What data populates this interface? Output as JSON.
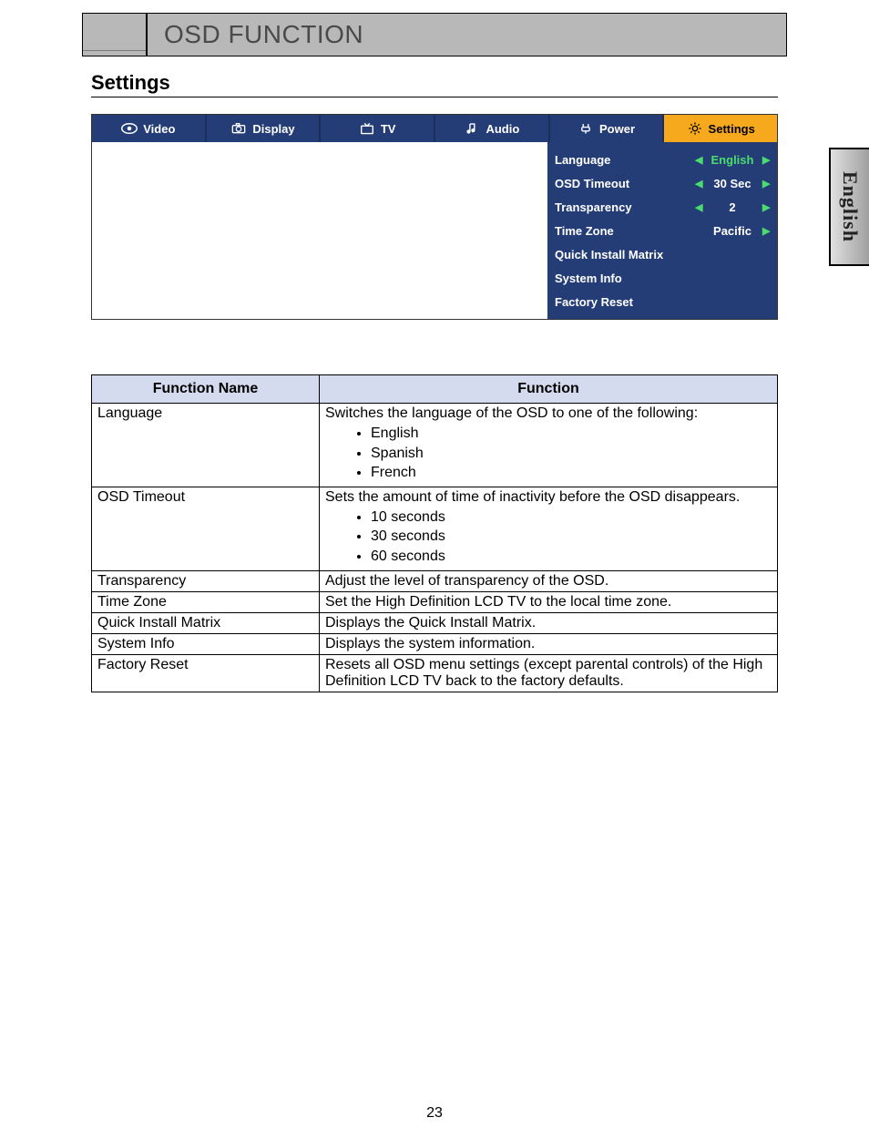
{
  "header": {
    "title": "OSD FUNCTION"
  },
  "section": {
    "title": "Settings"
  },
  "side_tab": "English",
  "page_number": "23",
  "osd": {
    "tabs": [
      {
        "label": "Video",
        "icon": "eye-icon"
      },
      {
        "label": "Display",
        "icon": "camera-icon"
      },
      {
        "label": "TV",
        "icon": "tv-icon"
      },
      {
        "label": "Audio",
        "icon": "note-icon"
      },
      {
        "label": "Power",
        "icon": "plug-icon"
      },
      {
        "label": "Settings",
        "icon": "gear-icon"
      }
    ],
    "active_tab": 5,
    "items": [
      {
        "label": "Language",
        "value": "English",
        "left": true,
        "right": true,
        "value_class": "lang"
      },
      {
        "label": "OSD Timeout",
        "value": "30 Sec",
        "left": true,
        "right": true,
        "value_class": ""
      },
      {
        "label": "Transparency",
        "value": "2",
        "left": true,
        "right": true,
        "value_class": ""
      },
      {
        "label": "Time Zone",
        "value": "Pacific",
        "left": false,
        "right": true,
        "value_class": ""
      },
      {
        "label": "Quick Install Matrix",
        "noval": true
      },
      {
        "label": "System Info",
        "noval": true
      },
      {
        "label": "Factory Reset",
        "noval": true
      }
    ]
  },
  "table": {
    "head": {
      "name": "Function Name",
      "func": "Function"
    },
    "rows": [
      {
        "name": "Language",
        "intro": "Switches the language of the OSD to one of the following:",
        "bullets": [
          "English",
          "Spanish",
          "French"
        ]
      },
      {
        "name": "OSD Timeout",
        "intro": "Sets the amount of time of inactivity before the OSD disappears.",
        "bullets": [
          "10 seconds",
          "30 seconds",
          "60 seconds"
        ]
      },
      {
        "name": "Transparency",
        "desc": "Adjust the level of transparency of the OSD."
      },
      {
        "name": "Time Zone",
        "desc": "Set the High Definition LCD TV to the local time zone."
      },
      {
        "name": "Quick Install Matrix",
        "desc": "Displays the Quick Install Matrix."
      },
      {
        "name": "System Info",
        "desc": "Displays the system information."
      },
      {
        "name": "Factory Reset",
        "desc": "Resets all OSD menu settings (except parental controls) of the High Definition LCD TV back to the factory defaults."
      }
    ]
  }
}
